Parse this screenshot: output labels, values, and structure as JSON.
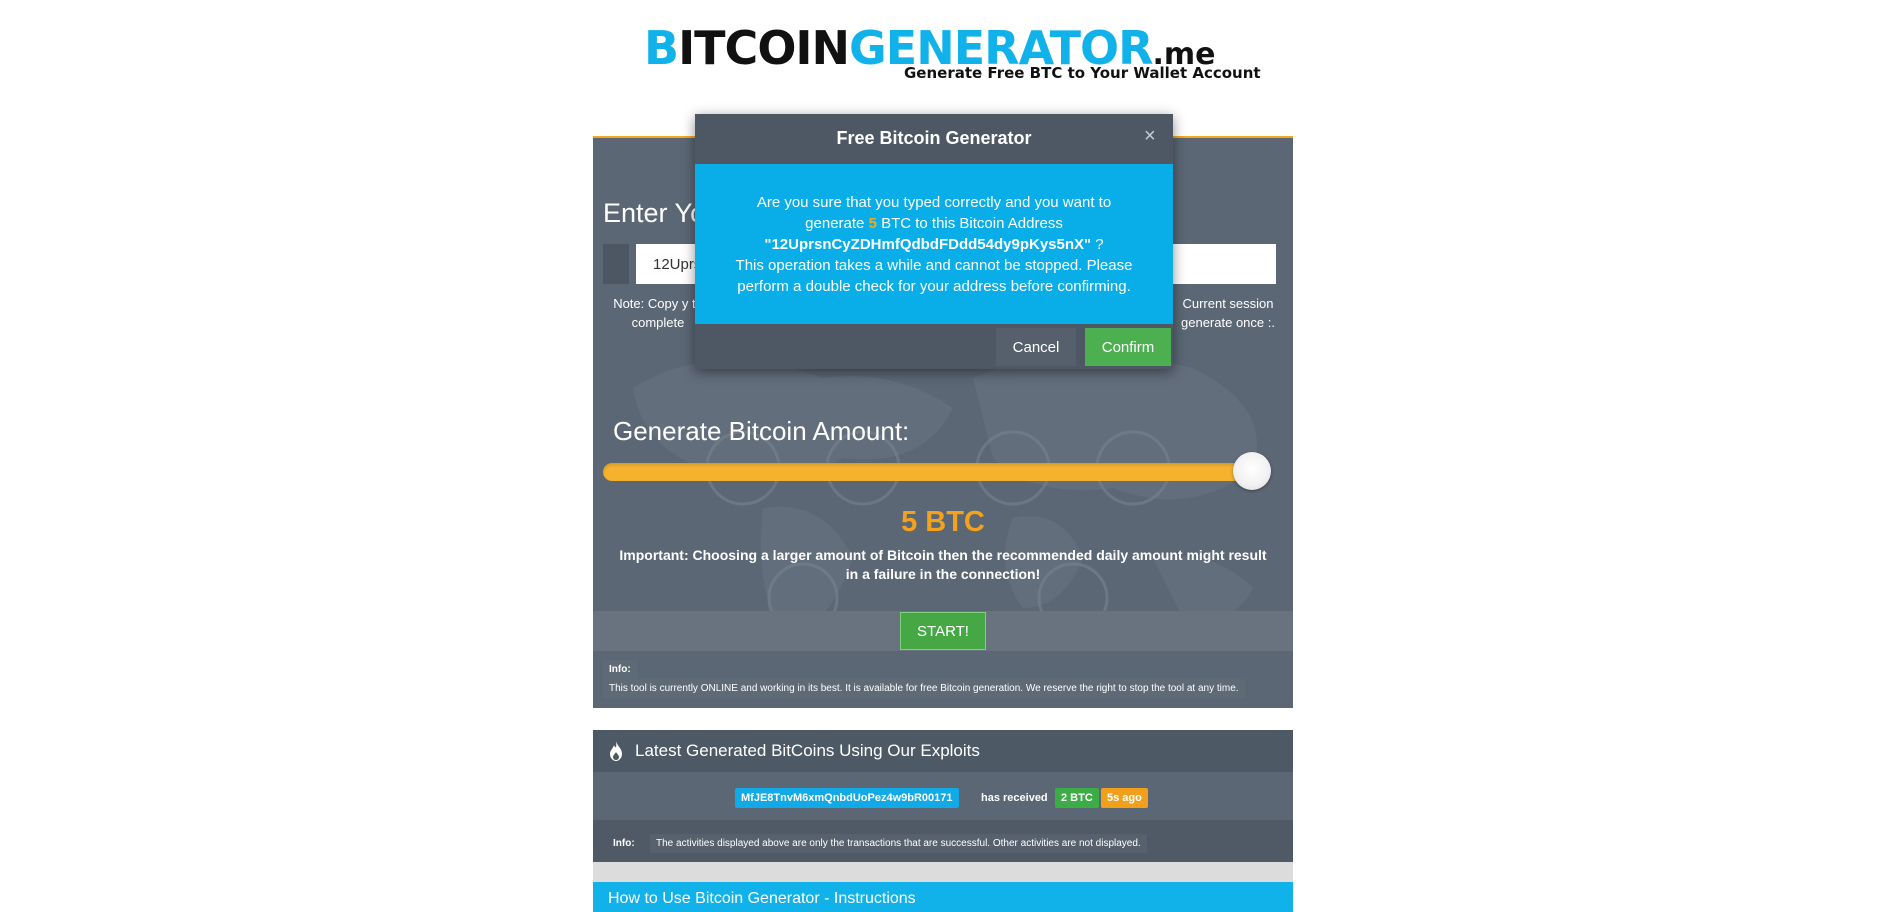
{
  "logo": {
    "text_b": "B",
    "text_itcoin": "ITCOIN",
    "text_generator": "GENERATOR",
    "text_tld": ".me",
    "tagline": "Generate Free BTC to Your Wallet Account"
  },
  "form": {
    "heading": "Enter Yo",
    "address_value": "12Uprs",
    "note_left": "Note: Copy y to complete",
    "note_right": "Current session generate once :.",
    "amount_heading": "Generate Bitcoin Amount:",
    "slider_fraction": 1.0,
    "amount_display": "5 BTC",
    "important": "Important: Choosing a larger amount of Bitcoin then the recommended daily amount might result in a failure in the connection!",
    "start_label": "START!",
    "info_label": "Info:",
    "info_text": "This tool is currently ONLINE and working in its best. It is available for free Bitcoin generation. We reserve the right to stop the tool at any time."
  },
  "latest": {
    "title": "Latest Generated BitCoins Using Our Exploits",
    "address": "MfJE8TnvM6xmQnbdUoPez4w9bR00171",
    "received": "has received",
    "amount": "2 BTC",
    "time": "5s ago",
    "info_label": "Info:",
    "info_text": "The activities displayed above are only the transactions that are successful. Other activities are not displayed."
  },
  "instructions": {
    "title": "How to Use Bitcoin Generator - Instructions"
  },
  "modal": {
    "title": "Free Bitcoin Generator",
    "close": "×",
    "line1": "Are you sure that you typed correctly and you want to",
    "line2_pre": "generate ",
    "amount": "5",
    "line2_post": " BTC  to this Bitcoin Address",
    "address": "\"12UprsnCyZDHmfQdbdFDdd54dy9pKys5nX\"",
    "address_suffix": " ?",
    "line3": "This operation takes a while and cannot be stopped. Please perform a double check for your address before confirming.",
    "cancel_label": "Cancel",
    "confirm_label": "Confirm"
  },
  "colors": {
    "accent_blue": "#09aee8",
    "panel": "#5b6775",
    "amber": "#f4a11c",
    "green": "#4caf50"
  }
}
